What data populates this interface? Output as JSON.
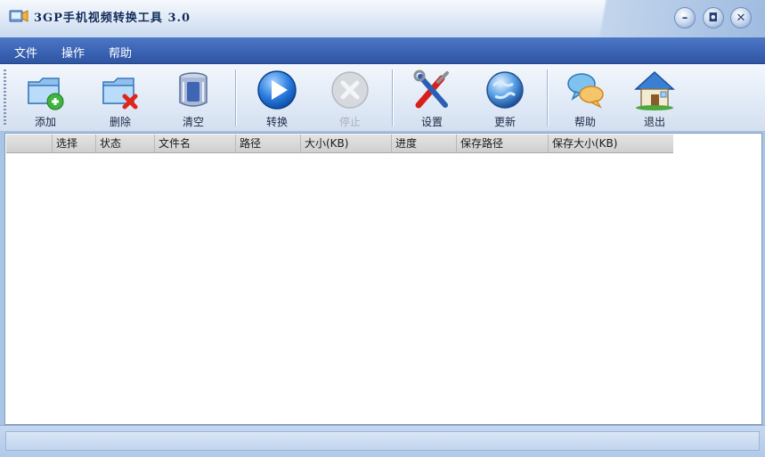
{
  "window": {
    "title": "3GP手机视频转换工具 3.0",
    "controls": [
      "minimize",
      "restore",
      "close"
    ]
  },
  "menu": {
    "items": [
      {
        "label": "文件"
      },
      {
        "label": "操作"
      },
      {
        "label": "帮助"
      }
    ]
  },
  "toolbar": {
    "buttons": [
      {
        "label": "添加",
        "icon": "add-folder-icon",
        "enabled": true
      },
      {
        "label": "删除",
        "icon": "delete-folder-icon",
        "enabled": true
      },
      {
        "label": "清空",
        "icon": "trash-bin-icon",
        "enabled": true
      },
      {
        "label": "转换",
        "icon": "play-icon",
        "enabled": true
      },
      {
        "label": "停止",
        "icon": "stop-icon",
        "enabled": false
      },
      {
        "label": "设置",
        "icon": "tools-icon",
        "enabled": true
      },
      {
        "label": "更新",
        "icon": "globe-icon",
        "enabled": true
      },
      {
        "label": "帮助",
        "icon": "chat-bubbles-icon",
        "enabled": true
      },
      {
        "label": "退出",
        "icon": "house-icon",
        "enabled": true
      }
    ]
  },
  "list": {
    "columns": [
      "选择",
      "状态",
      "文件名",
      "路径",
      "大小(KB)",
      "进度",
      "保存路径",
      "保存大小(KB)"
    ],
    "rows": []
  },
  "colors": {
    "menubar": "#3962b2",
    "titlebar": "#e2ebf7",
    "toolbar": "#e0e9f6",
    "list_background": "#ffffff"
  }
}
